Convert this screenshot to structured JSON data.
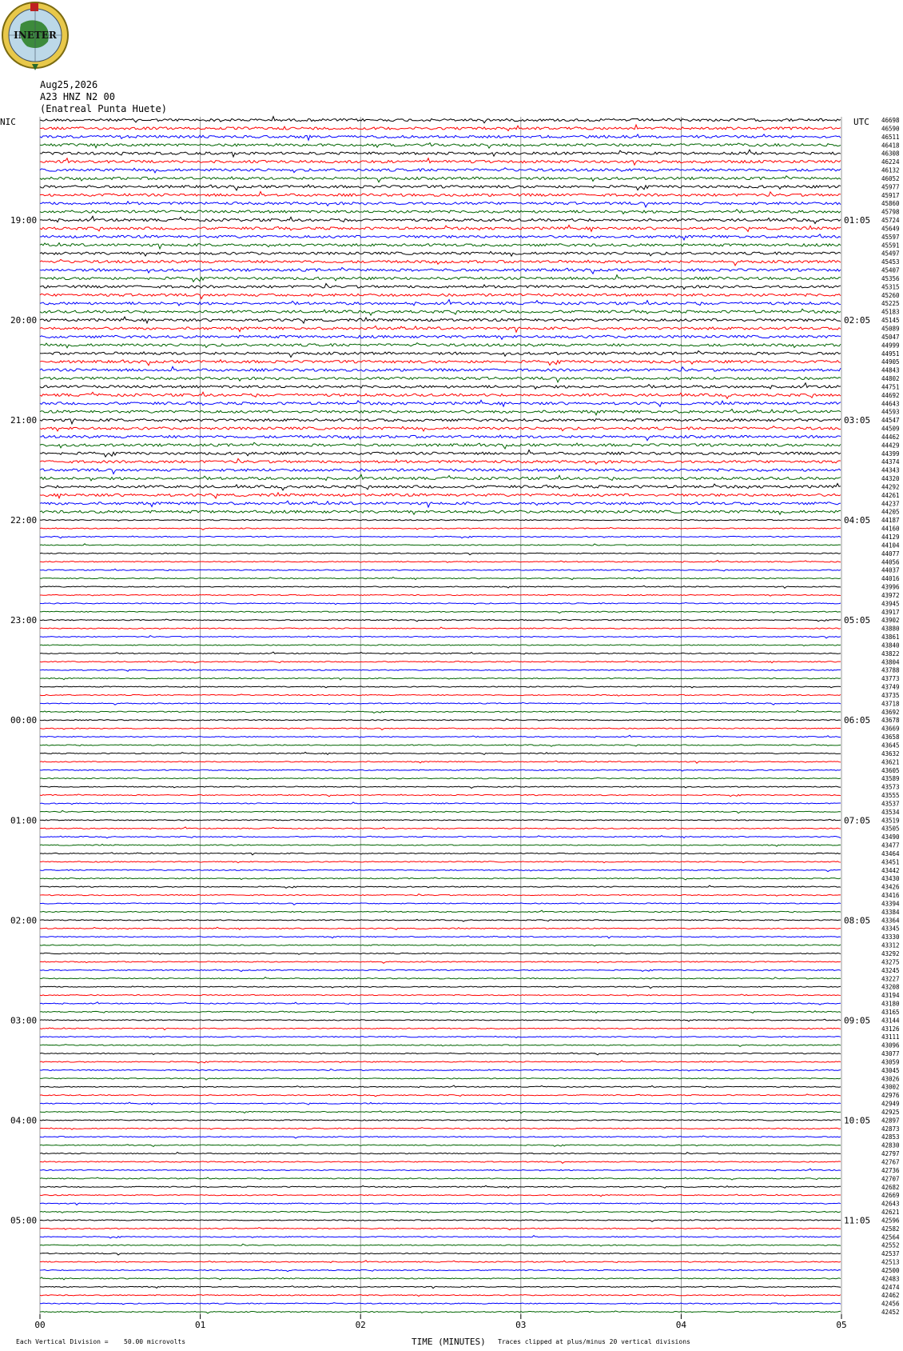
{
  "header": {
    "date": "Aug25,2026",
    "station": "A23 HNZ N2 00",
    "site": "(Enatreal Punta Huete)",
    "logo_text": "INETER"
  },
  "left_label": "NIC",
  "right_label": "UTC",
  "footer": {
    "scale_note": "Each Vertical Division =",
    "scale_value": "50.00 microvolts",
    "xlabel": "TIME (MINUTES)",
    "clip_note": "Traces clipped at plus/minus 20 vertical divisions"
  },
  "chart_data": {
    "type": "line",
    "title": "",
    "xlabel": "TIME (MINUTES)",
    "ylabel": "",
    "xlim": [
      0,
      5
    ],
    "x_ticks": [
      "00",
      "01",
      "02",
      "03",
      "04",
      "05"
    ],
    "grid": true,
    "trace_colors": [
      "#000000",
      "#ff0000",
      "#0000ff",
      "#006400"
    ],
    "left_time_labels": [
      "19:00",
      "20:00",
      "21:00",
      "22:00",
      "23:00",
      "00:00",
      "01:00",
      "02:00",
      "03:00",
      "04:00",
      "05:00"
    ],
    "right_time_labels": [
      "01:05",
      "02:05",
      "03:05",
      "04:05",
      "05:05",
      "06:05",
      "07:05",
      "08:05",
      "09:05",
      "10:05",
      "11:05"
    ],
    "trace_counts": [
      46698,
      46590,
      46511,
      46418,
      46308,
      46224,
      46132,
      46052,
      45977,
      45917,
      45860,
      45798,
      45724,
      45649,
      45597,
      45591,
      45497,
      45453,
      45407,
      45356,
      45315,
      45260,
      45225,
      45183,
      45145,
      45089,
      45047,
      44999,
      44951,
      44905,
      44843,
      44802,
      44751,
      44692,
      44643,
      44593,
      44547,
      44509,
      44462,
      44429,
      44399,
      44374,
      44343,
      44320,
      44292,
      44261,
      44237,
      44205,
      44187,
      44160,
      44129,
      44104,
      44077,
      44056,
      44037,
      44016,
      43996,
      43972,
      43945,
      43917,
      43902,
      43880,
      43861,
      43840,
      43822,
      43804,
      43788,
      43773,
      43749,
      43735,
      43718,
      43692,
      43678,
      43669,
      43658,
      43645,
      43632,
      43621,
      43605,
      43589,
      43573,
      43555,
      43537,
      43534,
      43519,
      43505,
      43490,
      43477,
      43464,
      43451,
      43442,
      43430,
      43426,
      43416,
      43394,
      43384,
      43364,
      43345,
      43330,
      43312,
      43292,
      43275,
      43245,
      43227,
      43208,
      43194,
      43180,
      43165,
      43144,
      43126,
      43111,
      43096,
      43077,
      43059,
      43045,
      43026,
      43002,
      42976,
      42949,
      42925,
      42897,
      42873,
      42853,
      42830,
      42797,
      42767,
      42736,
      42707,
      42682,
      42669,
      42643,
      42621,
      42596,
      42582,
      42564,
      42552,
      42537,
      42513,
      42500,
      42483,
      42474,
      42462,
      42456,
      42452
    ]
  }
}
